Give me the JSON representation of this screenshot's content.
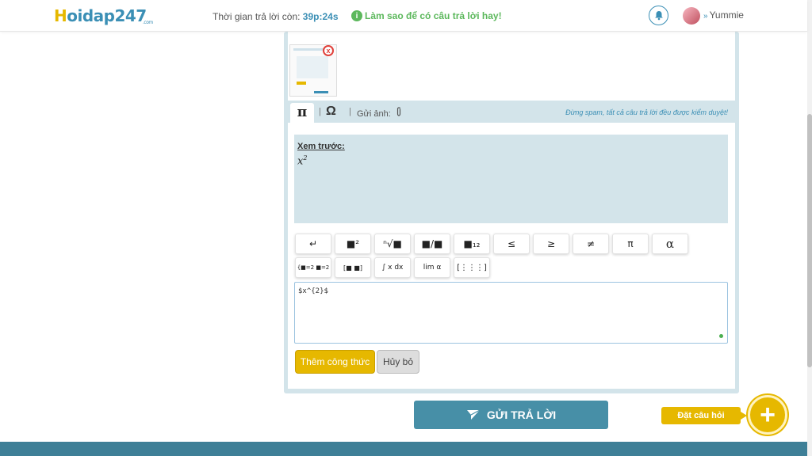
{
  "header": {
    "logo_h": "H",
    "logo_rest": "oidap247",
    "logo_com": ".com",
    "timer_label": "Thời gian trả lời còn:",
    "timer_value": "39p:24s",
    "tip_icon": "i",
    "tip_text": "Làm sao để có câu trả lời hay!",
    "bell_icon": "bell-icon",
    "user_chevron": "»",
    "user_name": "Yummie"
  },
  "attachment": {
    "close_symbol": "x"
  },
  "editor_toolbar": {
    "tab_pi": "π",
    "tab_omega": "Ω",
    "separator": "|",
    "send_image_label": "Gửi ảnh:",
    "clip_icon": "⌀",
    "spam_note": "Đừng spam, tất cả câu trả lời đều được kiểm duyệt!"
  },
  "preview": {
    "label": "Xem trước:",
    "math_base": "x",
    "math_exp": "2"
  },
  "symbols": {
    "row1": [
      "↵",
      "■²",
      "ⁿ√■",
      "■/■",
      "■₁₂",
      "≤",
      "≥",
      "≠",
      "π",
      "α"
    ],
    "row2": [
      "{■=2 ■=2",
      "[■ ■]",
      "∫ x dx",
      "lim α",
      "[⋮⋮⋮]"
    ]
  },
  "latex": {
    "value": "$x^{2}$"
  },
  "buttons": {
    "add_formula": "Thêm công thức",
    "cancel": "Hủy bỏ",
    "submit": "GỬI TRẢ LỜI",
    "ask_question": "Đặt câu hỏi",
    "ask_plus": "+"
  },
  "colors": {
    "brand_blue": "#3b8fb5",
    "brand_yellow": "#e6b800",
    "success_green": "#5cb85c"
  }
}
